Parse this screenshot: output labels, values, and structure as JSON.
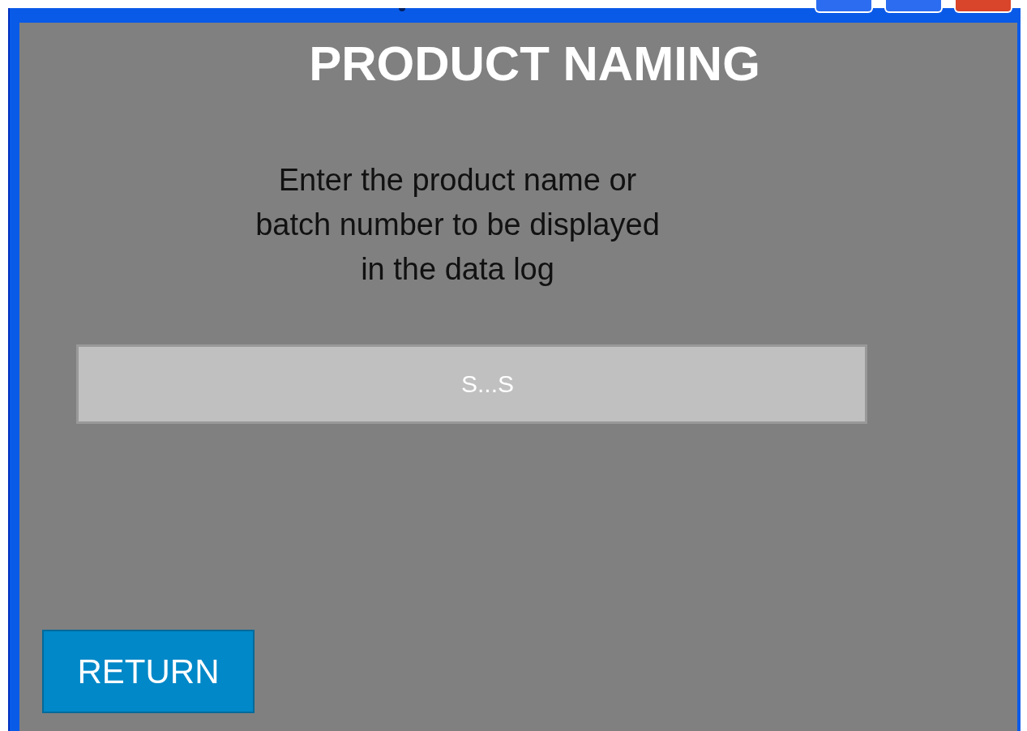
{
  "screen": {
    "title": "PRODUCT NAMING",
    "instruction": "Enter the product name or batch number to be displayed in the data log"
  },
  "name_field": {
    "value": "S...S"
  },
  "buttons": [
    {
      "label": "RETURN"
    }
  ]
}
